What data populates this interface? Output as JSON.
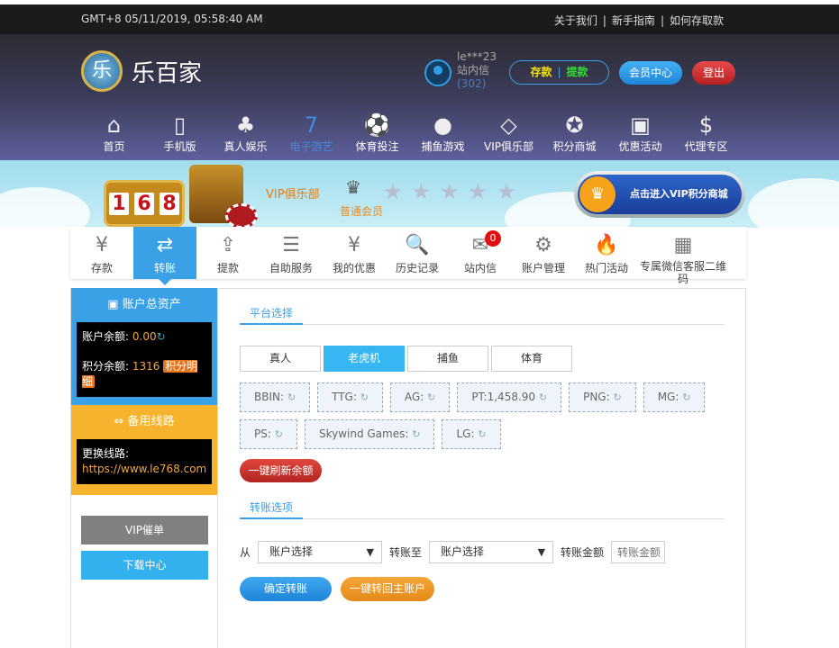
{
  "topbar": {
    "time": "GMT+8 05/11/2019, 05:58:40 AM",
    "links": [
      "关于我们",
      "新手指南",
      "如何存取款"
    ],
    "sep": "|"
  },
  "header": {
    "logo_text": "乐百家",
    "logo_glyph": "乐",
    "user": {
      "name": "le***23",
      "messages_label": "站内信",
      "messages_count": "(302)"
    },
    "deposit": "存款",
    "withdraw": "提款",
    "sep": "|",
    "member_center": "会员中心",
    "logout": "登出"
  },
  "mainnav": [
    {
      "label": "首页",
      "icon": "home-icon",
      "glyph": "⌂"
    },
    {
      "label": "手机版",
      "icon": "mobile-icon",
      "glyph": "▯"
    },
    {
      "label": "真人娱乐",
      "icon": "cards-icon",
      "glyph": "♣"
    },
    {
      "label": "电子游艺",
      "icon": "slot-icon",
      "glyph": "7",
      "active": true
    },
    {
      "label": "体育投注",
      "icon": "football-icon",
      "glyph": "⚽"
    },
    {
      "label": "捕鱼游戏",
      "icon": "fish-icon",
      "glyph": "●"
    },
    {
      "label": "VIP俱乐部",
      "icon": "diamond-icon",
      "glyph": "◇"
    },
    {
      "label": "积分商城",
      "icon": "medal-icon",
      "glyph": "✪"
    },
    {
      "label": "优惠活动",
      "icon": "gift-icon",
      "glyph": "▣"
    },
    {
      "label": "代理专区",
      "icon": "money-bag-icon",
      "glyph": "$"
    }
  ],
  "banner": {
    "slot_digits": [
      "1",
      "6",
      "8"
    ],
    "vip_label": "VIP俱乐部",
    "level": "普通会员",
    "stars": 5,
    "stars_filled": 0,
    "vip_mall_button": "点击进入VIP积分商城",
    "accent": "#f07b0c"
  },
  "subnav": [
    {
      "label": "存款",
      "icon": "money-bag-icon",
      "glyph": "¥"
    },
    {
      "label": "转账",
      "icon": "transfer-icon",
      "glyph": "⇄",
      "active": true
    },
    {
      "label": "提款",
      "icon": "withdraw-icon",
      "glyph": "⇪"
    },
    {
      "label": "自助服务",
      "icon": "form-icon",
      "glyph": "☰"
    },
    {
      "label": "我的优惠",
      "icon": "coupon-icon",
      "glyph": "¥"
    },
    {
      "label": "历史记录",
      "icon": "history-icon",
      "glyph": "🔍"
    },
    {
      "label": "站内信",
      "icon": "mail-icon",
      "glyph": "✉",
      "badge": "0"
    },
    {
      "label": "账户管理",
      "icon": "user-settings-icon",
      "glyph": "⚙"
    },
    {
      "label": "热门活动",
      "icon": "hot-icon",
      "glyph": "🔥"
    },
    {
      "label": "专属微信客服二维码",
      "icon": "qrcode-icon",
      "glyph": "▦"
    }
  ],
  "sidebar": {
    "assets_title": "账户总资产",
    "balance_label": "账户余额:",
    "balance": "0.00",
    "points_label": "积分余额:",
    "points": "1316",
    "points_detail": "积分明细",
    "spare_title": "备用线路",
    "switch_label": "更换线路:",
    "switch_url": "https://www.le768.com",
    "vip_bill": "VIP催单",
    "download": "下载中心"
  },
  "panel": {
    "platform_tab": "平台选择",
    "categories": [
      "真人",
      "老虎机",
      "捕鱼",
      "体育"
    ],
    "active_category": "老虎机",
    "platforms": [
      {
        "name": "BBIN:",
        "value": ""
      },
      {
        "name": "TTG:",
        "value": ""
      },
      {
        "name": "AG:",
        "value": ""
      },
      {
        "name": "PT:",
        "value": "1,458.90"
      },
      {
        "name": "PNG:",
        "value": ""
      },
      {
        "name": "MG:",
        "value": ""
      },
      {
        "name": "PS:",
        "value": ""
      },
      {
        "name": "Skywind Games:",
        "value": ""
      },
      {
        "name": "LG:",
        "value": ""
      }
    ],
    "refresh_all": "一键刷新余额",
    "transfer_tab": "转账选项",
    "from_label": "从",
    "from_value": "账户选择",
    "to_label": "转账至",
    "to_value": "账户选择",
    "amount_label": "转账金额",
    "amount_placeholder": "转账金额",
    "confirm": "确定转账",
    "back_to_main": "一键转回主账户"
  }
}
